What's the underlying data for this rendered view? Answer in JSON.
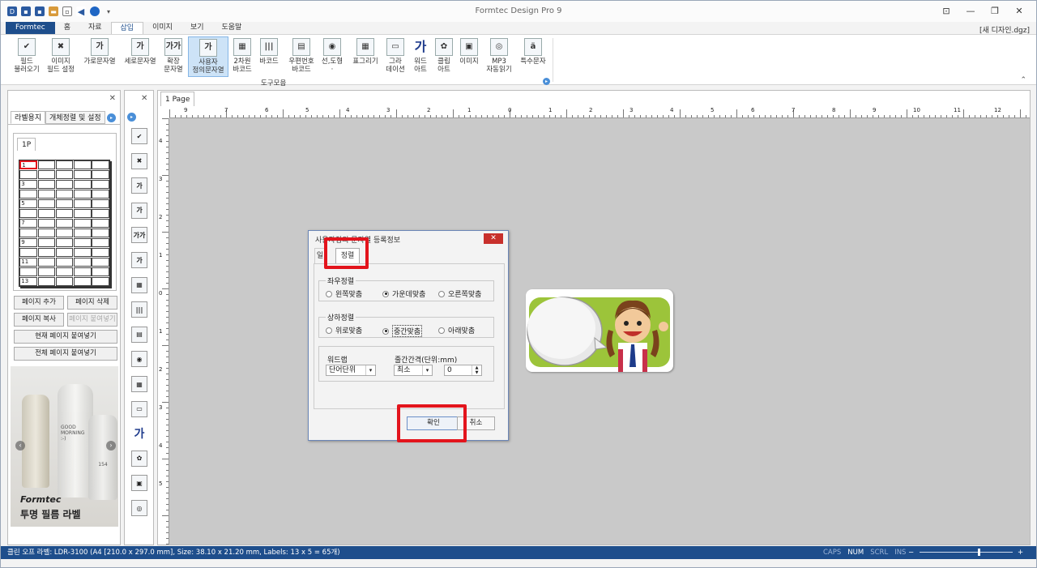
{
  "app": {
    "title": "Formtec Design Pro 9",
    "document": "[새 디자인.dgz]"
  },
  "window_controls": [
    "⊡",
    "—",
    "❐",
    "✕"
  ],
  "menu_tabs": [
    {
      "label": "Formtec",
      "file": true
    },
    {
      "label": "홈"
    },
    {
      "label": "자료"
    },
    {
      "label": "삽입",
      "active": true
    },
    {
      "label": "이미지"
    },
    {
      "label": "보기"
    },
    {
      "label": "도움말"
    }
  ],
  "ribbon": {
    "group_label": "도구모음",
    "buttons": [
      {
        "line1": "필드",
        "line2": "불러오기",
        "icon": "field-load-icon",
        "glyph": "✔"
      },
      {
        "line1": "이미지",
        "line2": "필드 설정",
        "icon": "image-field-icon",
        "glyph": "✖"
      },
      {
        "line1": "가로문자열",
        "line2": "",
        "icon": "horizontal-text-icon",
        "glyph": "가"
      },
      {
        "line1": "세로문자열",
        "line2": "",
        "icon": "vertical-text-icon",
        "glyph": "가"
      },
      {
        "line1": "확장",
        "line2": "문자열",
        "icon": "extended-text-icon",
        "glyph": "가가"
      },
      {
        "line1": "사용자",
        "line2": "정의문자열",
        "icon": "user-defined-text-icon",
        "glyph": "가",
        "active": true
      },
      {
        "line1": "2차원",
        "line2": "바코드",
        "icon": "qr-code-icon",
        "glyph": "▦"
      },
      {
        "line1": "바코드",
        "line2": "",
        "icon": "barcode-icon",
        "glyph": "|||"
      },
      {
        "line1": "우편번호",
        "line2": "바코드",
        "icon": "postal-barcode-icon",
        "glyph": "▤"
      },
      {
        "line1": "선,도형",
        "line2": "·",
        "icon": "shapes-icon",
        "glyph": "◉"
      },
      {
        "line1": "표그리기",
        "line2": "",
        "icon": "table-icon",
        "glyph": "▦"
      },
      {
        "line1": "그라",
        "line2": "데이션",
        "icon": "gradient-icon",
        "glyph": "▭"
      },
      {
        "line1": "워드",
        "line2": "아트",
        "icon": "wordart-icon",
        "glyph": "가"
      },
      {
        "line1": "클립",
        "line2": "아트",
        "icon": "clipart-icon",
        "glyph": "✿"
      },
      {
        "line1": "이미지",
        "line2": "",
        "icon": "image-icon",
        "glyph": "▣"
      },
      {
        "line1": "MP3",
        "line2": "자동읽기",
        "icon": "mp3-disc-icon",
        "glyph": "◎"
      },
      {
        "line1": "특수문자",
        "line2": "",
        "icon": "special-char-icon",
        "glyph": "ä"
      }
    ]
  },
  "left_panel": {
    "tabs": [
      "라벨용지",
      "개체정렬 및 설정"
    ],
    "page_tab": "1P",
    "row_labels": [
      "1",
      "3",
      "5",
      "7",
      "9",
      "11",
      "13"
    ],
    "buttons": {
      "add_page": "페이지 추가",
      "delete_page": "페이지 삭제",
      "copy_page": "페이지 복사",
      "paste_page": "페이지 붙여넣기",
      "paste_current": "현재 페이지 붙여넣기",
      "paste_all": "전체 페이지 붙여넣기"
    },
    "ad": {
      "bottle_text1": "GOOD",
      "bottle_text2": "MORNING",
      "bottle_text3": ":-)",
      "bottle_number": "154",
      "brand": "Formtec",
      "caption": "투명 필름 라벨"
    }
  },
  "toolbox_icons": [
    "field-load-icon",
    "image-field-icon",
    "horizontal-text-icon",
    "vertical-text-icon",
    "extended-text-icon",
    "user-defined-text-icon",
    "qr-code-icon",
    "barcode-icon",
    "postal-barcode-icon",
    "shapes-icon",
    "table-icon",
    "gradient-icon",
    "wordart-icon",
    "clipart-icon",
    "image-icon",
    "mp3-disc-icon"
  ],
  "design": {
    "page_tab": "1 Page",
    "hruler_labels": [
      "9",
      "7",
      "6",
      "5",
      "4",
      "3",
      "2",
      "1",
      "0",
      "1",
      "2",
      "3",
      "4",
      "5",
      "6",
      "7",
      "8",
      "9",
      "10",
      "11",
      "12"
    ],
    "vruler_labels": [
      "4",
      "3",
      "2",
      "1",
      "0",
      "1",
      "2",
      "3",
      "4",
      "5"
    ]
  },
  "dialog": {
    "title": "사용자정의 문자열 등록정보",
    "tabs": [
      "일",
      "정렬"
    ],
    "horizontal": {
      "legend": "좌우정렬",
      "options": [
        "왼쪽맞춤",
        "가운데맞춤",
        "오른쪽맞춤"
      ],
      "selected": 1
    },
    "vertical": {
      "legend": "상하정렬",
      "options": [
        "위로맞춤",
        "중간맞춤",
        "아래맞춤"
      ],
      "selected": 1
    },
    "wrap_label": "워드랩",
    "wrap_value": "단어단위",
    "spacing_label": "줄간간격(단위:mm)",
    "spacing_mode": "최소",
    "spacing_value": "0",
    "ok": "확인",
    "cancel": "취소"
  },
  "status": {
    "text": "클린 오프 라벨: LDR-3100 (A4 [210.0 x 297.0 mm], Size: 38.10 x 21.20 mm,  Labels: 13 x 5 = 65개)",
    "indicators": [
      "CAPS",
      "NUM",
      "SCRL",
      "INS"
    ],
    "zoom_minus": "−",
    "zoom_plus": "+"
  }
}
